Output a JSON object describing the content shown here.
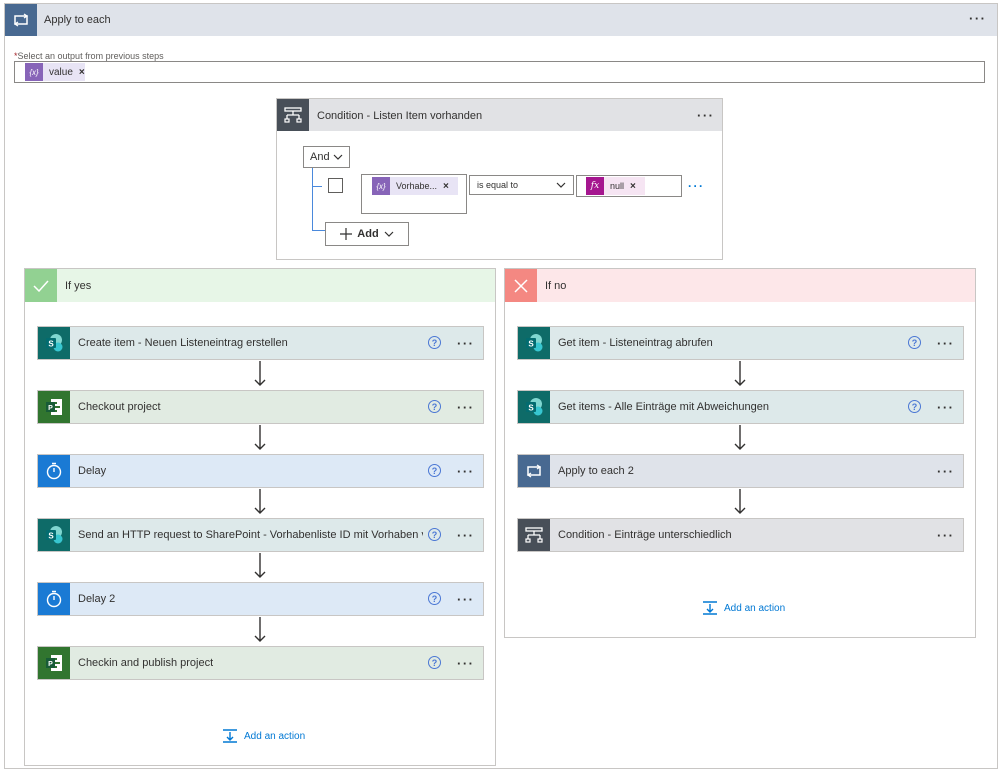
{
  "outer": {
    "title": "Apply to each",
    "select_label": "Select an output from previous steps",
    "required_mark": "*",
    "token": {
      "label": "value",
      "icon": "expression-icon",
      "color": "#8764b8"
    }
  },
  "condition": {
    "title": "Condition - Listen Item vorhanden",
    "and_label": "And",
    "left_token": "Vorhabe...",
    "operator": "is equal to",
    "right_token": "null",
    "add_label": "Add"
  },
  "yes_branch": {
    "title": "If yes",
    "actions": [
      {
        "label": "Create item - Neuen Listeneintrag erstellen",
        "type": "sharepoint"
      },
      {
        "label": "Checkout project",
        "type": "project"
      },
      {
        "label": "Delay",
        "type": "delay"
      },
      {
        "label": "Send an HTTP request to SharePoint - Vorhabenliste ID mit Vorhaben ver...",
        "type": "sharepoint"
      },
      {
        "label": "Delay 2",
        "type": "delay"
      },
      {
        "label": "Checkin and publish project",
        "type": "project"
      }
    ],
    "add_action": "Add an action"
  },
  "no_branch": {
    "title": "If no",
    "actions": [
      {
        "label": "Get item - Listeneintrag abrufen",
        "type": "sharepoint"
      },
      {
        "label": "Get items - Alle Einträge mit Abweichungen",
        "type": "sharepoint"
      },
      {
        "label": "Apply to each 2",
        "type": "loop"
      },
      {
        "label": "Condition - Einträge unterschiedlich",
        "type": "condition"
      }
    ],
    "add_action": "Add an action"
  },
  "colors": {
    "sharepoint": "#0e6b68",
    "project": "#31752f",
    "delay": "#1a7ad4",
    "loop": "#486991",
    "condition": "#484f58",
    "expression_token": "#8764b8",
    "function_token": "#a5168f",
    "link": "#0078d4"
  }
}
